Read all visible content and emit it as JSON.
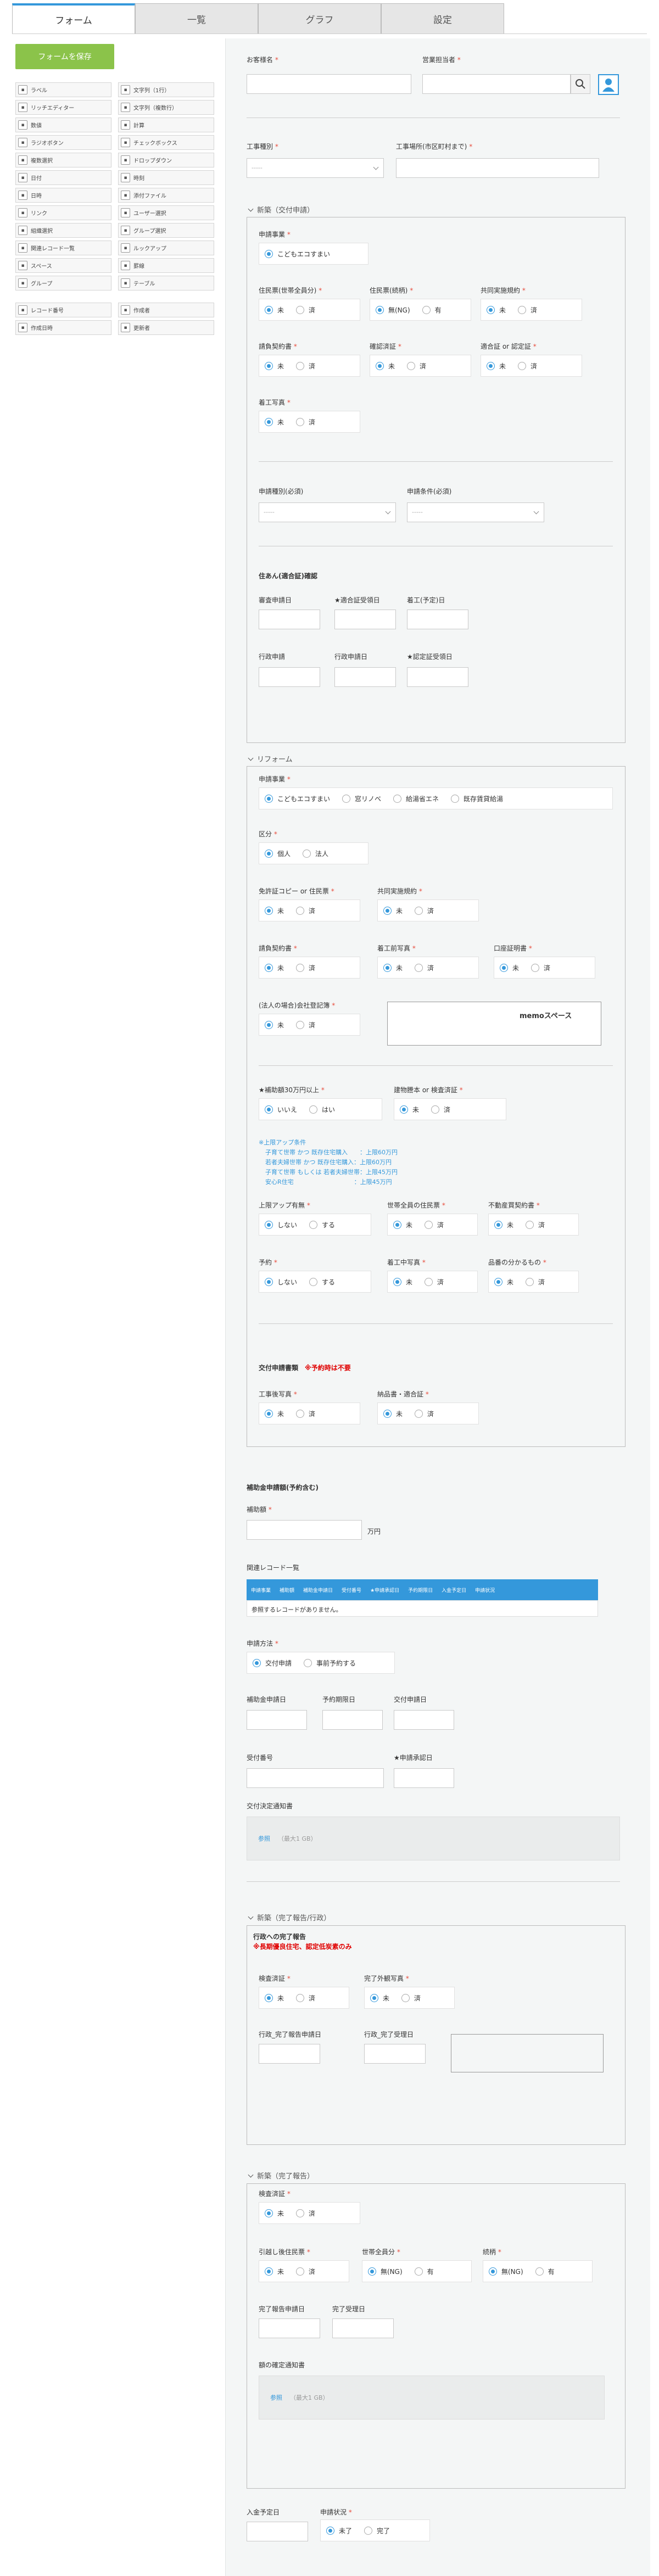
{
  "tabs": {
    "form": "フォーム",
    "list": "一覧",
    "graph": "グラフ",
    "settings": "設定"
  },
  "save_label": "フォームを保存",
  "palette": [
    {
      "label": "ラベル",
      "icon": "label-icon"
    },
    {
      "label": "文字列（1行）",
      "icon": "text-line-icon"
    },
    {
      "label": "リッチエディター",
      "icon": "rich-editor-icon"
    },
    {
      "label": "文字列（複数行）",
      "icon": "text-multiline-icon"
    },
    {
      "label": "数値",
      "icon": "number-icon"
    },
    {
      "label": "計算",
      "icon": "calc-icon"
    },
    {
      "label": "ラジオボタン",
      "icon": "radio-icon"
    },
    {
      "label": "チェックボックス",
      "icon": "checkbox-icon"
    },
    {
      "label": "複数選択",
      "icon": "multi-select-icon"
    },
    {
      "label": "ドロップダウン",
      "icon": "dropdown-icon"
    },
    {
      "label": "日付",
      "icon": "date-icon"
    },
    {
      "label": "時刻",
      "icon": "time-icon"
    },
    {
      "label": "日時",
      "icon": "datetime-icon"
    },
    {
      "label": "添付ファイル",
      "icon": "attachment-icon"
    },
    {
      "label": "リンク",
      "icon": "link-icon"
    },
    {
      "label": "ユーザー選択",
      "icon": "user-select-icon"
    },
    {
      "label": "組織選択",
      "icon": "org-select-icon"
    },
    {
      "label": "グループ選択",
      "icon": "group-select-icon"
    },
    {
      "label": "関連レコード一覧",
      "icon": "related-records-icon"
    },
    {
      "label": "ルックアップ",
      "icon": "lookup-icon"
    },
    {
      "label": "スペース",
      "icon": "space-icon"
    },
    {
      "label": "罫線",
      "icon": "border-icon"
    },
    {
      "label": "グループ",
      "icon": "group-icon"
    },
    {
      "label": "テーブル",
      "icon": "table-icon"
    }
  ],
  "palette2": [
    {
      "label": "レコード番号",
      "icon": "record-number-icon"
    },
    {
      "label": "作成者",
      "icon": "creator-icon"
    },
    {
      "label": "作成日時",
      "icon": "created-at-icon"
    },
    {
      "label": "更新者",
      "icon": "updater-icon"
    }
  ],
  "top": {
    "customer": "お客様名",
    "sales": "営業担当者"
  },
  "kind": {
    "type": "工事種別",
    "place": "工事場所(市区町村まで)",
    "placeholder": "-----"
  },
  "g1": {
    "title": "新築（交付申請）",
    "project": "申請事業",
    "project_opt": "こどもエコすまい",
    "f1": "住民票(世帯全員分)",
    "f2": "住民票(続柄)",
    "f3": "共同実施規約",
    "f4": "請負契約書",
    "f5": "確認済証",
    "f6": "適合証 or 認定証",
    "f7": "着工写真",
    "mi": "未",
    "zumi": "済",
    "mu": "無(NG)",
    "ari": "有",
    "type": "申請種別(必須)",
    "cond": "申請条件(必須)",
    "sub": "住あん(適合証)確認",
    "d1": "審査申請日",
    "d2": "★適合証受領日",
    "d3": "着工(予定)日",
    "d4": "行政申請",
    "d5": "行政申請日",
    "d6": "★認定証受領日"
  },
  "g2": {
    "title": "リフォーム",
    "project": "申請事業",
    "projects": [
      "こどもエコすまい",
      "窓リノベ",
      "給湯省エネ",
      "既存賃貸給湯"
    ],
    "kubun": "区分",
    "kojin": "個人",
    "hojin": "法人",
    "a1": "免許証コピー or 住民票",
    "a2": "共同実施規約",
    "a3": "請負契約書",
    "a4": "着工前写真",
    "a5": "口座証明書",
    "a6": "(法人の場合)会社登記簿",
    "memo": "memoスペース",
    "b1": "★補助額30万円以上",
    "iie": "いいえ",
    "hai": "はい",
    "b2": "建物謄本 or 検査済証",
    "notes": [
      "※上限アップ条件",
      "子育て世帯 かつ 既存住宅購入　　：上限60万円",
      "若者夫婦世帯 かつ 既存住宅購入：上限60万円",
      "子育て世帯 もしくは 若者夫婦世帯：上限45万円",
      "安心R住宅　　　　　　　　　　：上限45万円"
    ],
    "c1": "上限アップ有無",
    "shinai": "しない",
    "suru": "する",
    "c2": "世帯全員の住民票",
    "c3": "不動産買契約書",
    "c4": "予約",
    "c5": "着工中写真",
    "c6": "品番の分かるもの",
    "kofu": "交付申請書類",
    "kofu_note": "※予約時は不要",
    "e1": "工事後写真",
    "e2": "納品書・適合証"
  },
  "hojo": {
    "title": "補助金申請額(予約含む)",
    "amount": "補助額",
    "unit": "万円",
    "related": "関連レコード一覧",
    "cols": [
      "申請事業",
      "補助額",
      "補助金申請日",
      "受付番号",
      "★申請承認日",
      "予約期限日",
      "入金予定日",
      "申請状況"
    ],
    "empty": "参照するレコードがありません。",
    "method": "申請方法",
    "m1": "交付申請",
    "m2": "事前予約する",
    "f1": "補助金申請日",
    "f2": "予約期限日",
    "f3": "交付申請日",
    "f4": "受付番号",
    "f5": "★申請承認日",
    "notice": "交付決定通知書",
    "ref": "参照",
    "max": "（最大1 GB）"
  },
  "g3": {
    "title": "新築（完了報告/行政）",
    "sub": "行政への完了報告",
    "note": "※長期優良住宅、認定低炭素のみ",
    "k1": "検査済証",
    "k2": "完了外観写真",
    "k3": "行政_完了報告申請日",
    "k4": "行政_完了受理日"
  },
  "g4": {
    "title": "新築（完了報告）",
    "k1": "検査済証",
    "k2": "引越し後住民票",
    "k3": "世帯全員分",
    "k4": "続柄",
    "k5": "完了報告申請日",
    "k6": "完了受理日",
    "k7": "額の確定通知書"
  },
  "bottom": {
    "nyukin": "入金予定日",
    "status": "申請状況",
    "s1": "未了",
    "s2": "完了"
  }
}
